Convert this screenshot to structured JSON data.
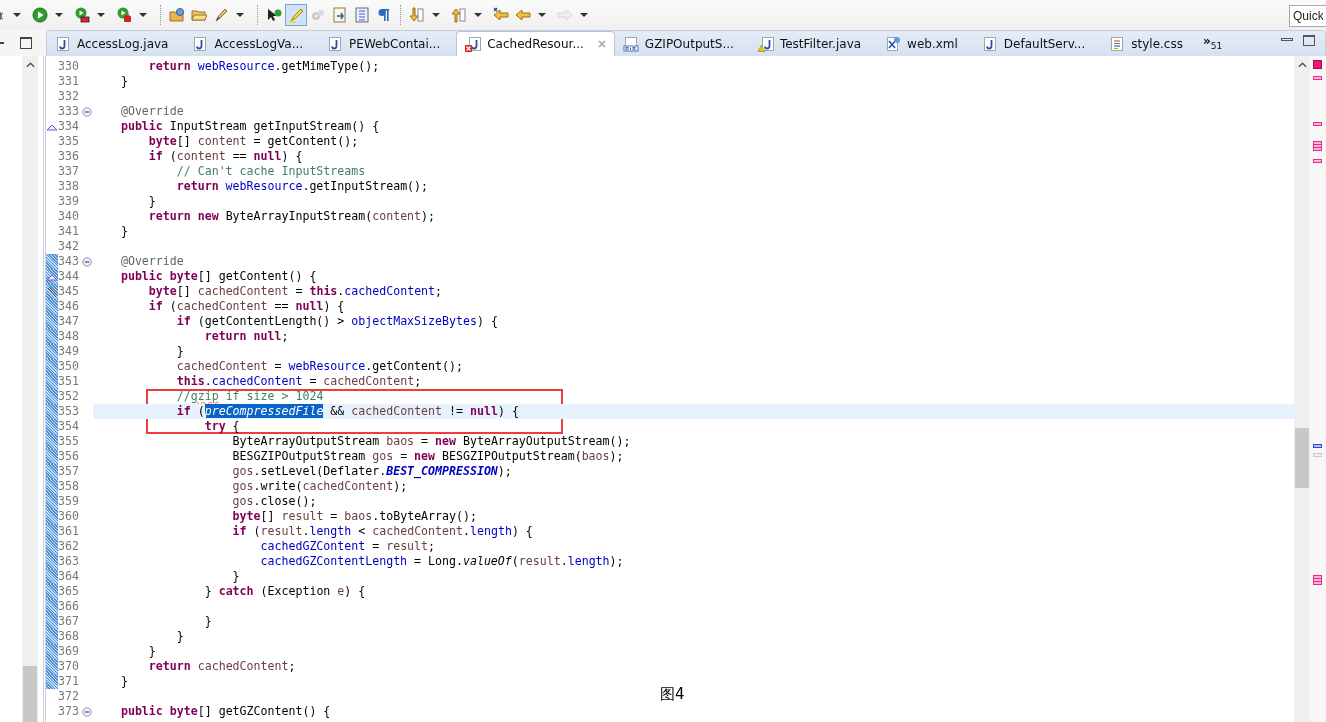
{
  "toolbar": [
    {
      "kind": "debug",
      "menu": true,
      "on": false,
      "disabled": false
    },
    {
      "kind": "run",
      "menu": true,
      "on": false,
      "disabled": false
    },
    {
      "kind": "coverage",
      "menu": true,
      "on": false,
      "disabled": false
    },
    {
      "kind": "external-tools",
      "menu": true,
      "on": false,
      "disabled": false
    },
    {
      "kind": "separator"
    },
    {
      "kind": "open-project",
      "menu": false,
      "on": false,
      "disabled": false
    },
    {
      "kind": "open-folder",
      "menu": false,
      "on": false,
      "disabled": false
    },
    {
      "kind": "brush",
      "menu": true,
      "on": false,
      "disabled": false
    },
    {
      "kind": "separator"
    },
    {
      "kind": "cursor-run",
      "menu": false,
      "on": false,
      "disabled": false
    },
    {
      "kind": "highlighter",
      "menu": false,
      "on": true,
      "disabled": false
    },
    {
      "kind": "gears",
      "menu": false,
      "on": false,
      "disabled": true
    },
    {
      "kind": "doc-arrow",
      "menu": false,
      "on": false,
      "disabled": false
    },
    {
      "kind": "doc-list",
      "menu": false,
      "on": false,
      "disabled": false
    },
    {
      "kind": "pilcrow",
      "menu": false,
      "on": false,
      "disabled": false
    },
    {
      "kind": "separator"
    },
    {
      "kind": "next-annotation",
      "menu": true,
      "on": false,
      "disabled": false
    },
    {
      "kind": "prev-annotation",
      "menu": true,
      "on": false,
      "disabled": false
    },
    {
      "kind": "last-edit",
      "menu": false,
      "on": false,
      "disabled": false
    },
    {
      "kind": "back",
      "menu": true,
      "on": false,
      "disabled": false
    },
    {
      "kind": "forward",
      "menu": true,
      "on": false,
      "disabled": true
    }
  ],
  "quick_access": {
    "placeholder": "Quick"
  },
  "tabs": [
    {
      "label": "AccessLog.java",
      "kind": "java",
      "selected": false
    },
    {
      "label": "AccessLogVa...",
      "kind": "java",
      "selected": false
    },
    {
      "label": "PEWebContai...",
      "kind": "java",
      "selected": false
    },
    {
      "label": "CachedResour...",
      "kind": "java-error",
      "selected": true
    },
    {
      "label": "GZIPOutputS...",
      "kind": "class",
      "selected": false
    },
    {
      "label": "TestFilter.java",
      "kind": "java-warning",
      "selected": false
    },
    {
      "label": "web.xml",
      "kind": "xml",
      "selected": false
    },
    {
      "label": "DefaultServ...",
      "kind": "java",
      "selected": false
    },
    {
      "label": "style.css",
      "kind": "css",
      "selected": false
    }
  ],
  "tab_overflow": {
    "symbol": "»",
    "count": "51"
  },
  "lines": [
    {
      "number": "330",
      "changed": false,
      "current": false,
      "boxed": false,
      "tokens": [
        {
          "kind": "kw",
          "text": "        return"
        },
        {
          "kind": "field",
          "text": " webResource"
        },
        {
          "kind": "plain",
          "text": ".getMimeType();"
        }
      ]
    },
    {
      "number": "331",
      "changed": false,
      "current": false,
      "boxed": false,
      "tokens": [
        {
          "kind": "plain",
          "text": "    }"
        }
      ]
    },
    {
      "number": "332",
      "changed": false,
      "current": false,
      "boxed": false
    },
    {
      "number": "333",
      "changed": false,
      "current": false,
      "boxed": false,
      "fold": {
        "collapsed": false
      },
      "tokens": [
        {
          "kind": "annot",
          "text": "    @Override"
        }
      ]
    },
    {
      "number": "334",
      "changed": false,
      "current": false,
      "boxed": false,
      "marker": {
        "kind": "override"
      },
      "tokens": [
        {
          "kind": "kw",
          "text": "    public"
        },
        {
          "kind": "plain",
          "text": " InputStream getInputStream() {"
        }
      ]
    },
    {
      "number": "335",
      "changed": false,
      "current": false,
      "boxed": false,
      "tokens": [
        {
          "kind": "kw",
          "text": "        byte"
        },
        {
          "kind": "plain",
          "text": "[] "
        },
        {
          "kind": "local",
          "text": "content"
        },
        {
          "kind": "plain",
          "text": " = getContent();"
        }
      ]
    },
    {
      "number": "336",
      "changed": false,
      "current": false,
      "boxed": false,
      "tokens": [
        {
          "kind": "kw",
          "text": "        if"
        },
        {
          "kind": "plain",
          "text": " ("
        },
        {
          "kind": "local",
          "text": "content"
        },
        {
          "kind": "plain",
          "text": " =="
        },
        {
          "kind": "kw",
          "text": " null"
        },
        {
          "kind": "plain",
          "text": ") {"
        }
      ]
    },
    {
      "number": "337",
      "changed": false,
      "current": false,
      "boxed": false,
      "tokens": [
        {
          "kind": "comment",
          "text": "            // Can't cache InputStreams"
        }
      ]
    },
    {
      "number": "338",
      "changed": false,
      "current": false,
      "boxed": false,
      "tokens": [
        {
          "kind": "kw",
          "text": "            return"
        },
        {
          "kind": "field",
          "text": " webResource"
        },
        {
          "kind": "plain",
          "text": ".getInputStream();"
        }
      ]
    },
    {
      "number": "339",
      "changed": false,
      "current": false,
      "boxed": false,
      "tokens": [
        {
          "kind": "plain",
          "text": "        }"
        }
      ]
    },
    {
      "number": "340",
      "changed": false,
      "current": false,
      "boxed": false,
      "tokens": [
        {
          "kind": "kw",
          "text": "        return"
        },
        {
          "kind": "kw",
          "text": " new"
        },
        {
          "kind": "plain",
          "text": " ByteArrayInputStream("
        },
        {
          "kind": "local",
          "text": "content"
        },
        {
          "kind": "plain",
          "text": ");"
        }
      ]
    },
    {
      "number": "341",
      "changed": false,
      "current": false,
      "boxed": false,
      "tokens": [
        {
          "kind": "plain",
          "text": "    }"
        }
      ]
    },
    {
      "number": "342",
      "changed": false,
      "current": false,
      "boxed": false
    },
    {
      "number": "343",
      "changed": true,
      "current": false,
      "boxed": false,
      "fold": {
        "collapsed": false
      },
      "tokens": [
        {
          "kind": "annot",
          "text": "    @Override"
        }
      ]
    },
    {
      "number": "344",
      "changed": true,
      "current": false,
      "boxed": false,
      "marker": {
        "kind": "override"
      },
      "tokens": [
        {
          "kind": "kw",
          "text": "    public"
        },
        {
          "kind": "kw",
          "text": " byte"
        },
        {
          "kind": "plain",
          "text": "[] getContent() {"
        }
      ]
    },
    {
      "number": "345",
      "changed": true,
      "current": false,
      "boxed": false,
      "marker": {
        "kind": "deleted"
      },
      "tokens": [
        {
          "kind": "kw",
          "text": "        byte"
        },
        {
          "kind": "plain",
          "text": "[] "
        },
        {
          "kind": "local",
          "text": "cachedContent"
        },
        {
          "kind": "plain",
          "text": " ="
        },
        {
          "kind": "kw",
          "text": " this"
        },
        {
          "kind": "plain",
          "text": "."
        },
        {
          "kind": "field",
          "text": "cachedContent"
        },
        {
          "kind": "plain",
          "text": ";"
        }
      ]
    },
    {
      "number": "346",
      "changed": true,
      "current": false,
      "boxed": false,
      "tokens": [
        {
          "kind": "kw",
          "text": "        if"
        },
        {
          "kind": "plain",
          "text": " ("
        },
        {
          "kind": "local",
          "text": "cachedContent"
        },
        {
          "kind": "plain",
          "text": " =="
        },
        {
          "kind": "kw",
          "text": " null"
        },
        {
          "kind": "plain",
          "text": ") {"
        }
      ]
    },
    {
      "number": "347",
      "changed": true,
      "current": false,
      "boxed": false,
      "tokens": [
        {
          "kind": "kw",
          "text": "            if"
        },
        {
          "kind": "plain",
          "text": " (getContentLength() >"
        },
        {
          "kind": "field",
          "text": " objectMaxSizeBytes"
        },
        {
          "kind": "plain",
          "text": ") {"
        }
      ]
    },
    {
      "number": "348",
      "changed": true,
      "current": false,
      "boxed": false,
      "tokens": [
        {
          "kind": "kw",
          "text": "                return"
        },
        {
          "kind": "kw",
          "text": " null"
        },
        {
          "kind": "plain",
          "text": ";"
        }
      ]
    },
    {
      "number": "349",
      "changed": true,
      "current": false,
      "boxed": false,
      "tokens": [
        {
          "kind": "plain",
          "text": "            }"
        }
      ]
    },
    {
      "number": "350",
      "changed": true,
      "current": false,
      "boxed": false,
      "tokens": [
        {
          "kind": "local",
          "text": "            cachedContent"
        },
        {
          "kind": "plain",
          "text": " ="
        },
        {
          "kind": "field",
          "text": " webResource"
        },
        {
          "kind": "plain",
          "text": ".getContent();"
        }
      ]
    },
    {
      "number": "351",
      "changed": true,
      "current": false,
      "boxed": false,
      "tokens": [
        {
          "kind": "kw",
          "text": "            this"
        },
        {
          "kind": "plain",
          "text": "."
        },
        {
          "kind": "field",
          "text": "cachedContent"
        },
        {
          "kind": "plain",
          "text": " ="
        },
        {
          "kind": "local",
          "text": " cachedContent"
        },
        {
          "kind": "plain",
          "text": ";"
        }
      ]
    },
    {
      "number": "352",
      "changed": true,
      "current": false,
      "boxed": true,
      "tokens": [
        {
          "kind": "comment",
          "text": "            //"
        },
        {
          "kind": "comment-typo",
          "text": "gzip"
        },
        {
          "kind": "comment",
          "text": " if size > 1024"
        }
      ]
    },
    {
      "number": "353",
      "changed": true,
      "current": true,
      "boxed": true,
      "tokens": [
        {
          "kind": "kw",
          "text": "            if"
        },
        {
          "kind": "plain",
          "text": " ("
        },
        {
          "kind": "selected",
          "text": "preCompressedFile"
        },
        {
          "kind": "plain",
          "text": " &&"
        },
        {
          "kind": "local",
          "text": " cachedContent"
        },
        {
          "kind": "plain",
          "text": " !="
        },
        {
          "kind": "kw",
          "text": " null"
        },
        {
          "kind": "plain",
          "text": ") {"
        }
      ]
    },
    {
      "number": "354",
      "changed": true,
      "current": false,
      "boxed": true,
      "tokens": [
        {
          "kind": "kw",
          "text": "                try"
        },
        {
          "kind": "plain",
          "text": " {"
        }
      ]
    },
    {
      "number": "355",
      "changed": true,
      "current": false,
      "boxed": false,
      "tokens": [
        {
          "kind": "plain",
          "text": "                    ByteArrayOutputStream"
        },
        {
          "kind": "local",
          "text": " baos"
        },
        {
          "kind": "plain",
          "text": " ="
        },
        {
          "kind": "kw",
          "text": " new"
        },
        {
          "kind": "plain",
          "text": " ByteArrayOutputStream();"
        }
      ]
    },
    {
      "number": "356",
      "changed": true,
      "current": false,
      "boxed": false,
      "tokens": [
        {
          "kind": "plain",
          "text": "                    BESGZIPOutputStream"
        },
        {
          "kind": "local",
          "text": " gos"
        },
        {
          "kind": "plain",
          "text": " ="
        },
        {
          "kind": "kw",
          "text": " new"
        },
        {
          "kind": "plain",
          "text": " BESGZIPOutputStream("
        },
        {
          "kind": "local",
          "text": "baos"
        },
        {
          "kind": "plain",
          "text": ");"
        }
      ]
    },
    {
      "number": "357",
      "changed": true,
      "current": false,
      "boxed": false,
      "tokens": [
        {
          "kind": "local",
          "text": "                    gos"
        },
        {
          "kind": "plain",
          "text": ".setLevel(Deflater."
        },
        {
          "kind": "static",
          "text": "BEST_COMPRESSION"
        },
        {
          "kind": "plain",
          "text": ");"
        }
      ]
    },
    {
      "number": "358",
      "changed": true,
      "current": false,
      "boxed": false,
      "tokens": [
        {
          "kind": "local",
          "text": "                    gos"
        },
        {
          "kind": "plain",
          "text": ".write("
        },
        {
          "kind": "local",
          "text": "cachedContent"
        },
        {
          "kind": "plain",
          "text": ");"
        }
      ]
    },
    {
      "number": "359",
      "changed": true,
      "current": false,
      "boxed": false,
      "tokens": [
        {
          "kind": "local",
          "text": "                    gos"
        },
        {
          "kind": "plain",
          "text": ".close();"
        }
      ]
    },
    {
      "number": "360",
      "changed": true,
      "current": false,
      "boxed": false,
      "tokens": [
        {
          "kind": "kw",
          "text": "                    byte"
        },
        {
          "kind": "plain",
          "text": "[] "
        },
        {
          "kind": "local",
          "text": "result"
        },
        {
          "kind": "plain",
          "text": " ="
        },
        {
          "kind": "local",
          "text": " baos"
        },
        {
          "kind": "plain",
          "text": ".toByteArray();"
        }
      ]
    },
    {
      "number": "361",
      "changed": true,
      "current": false,
      "boxed": false,
      "tokens": [
        {
          "kind": "kw",
          "text": "                    if"
        },
        {
          "kind": "plain",
          "text": " ("
        },
        {
          "kind": "local",
          "text": "result"
        },
        {
          "kind": "plain",
          "text": "."
        },
        {
          "kind": "field",
          "text": "length"
        },
        {
          "kind": "plain",
          "text": " <"
        },
        {
          "kind": "local",
          "text": " cachedContent"
        },
        {
          "kind": "plain",
          "text": "."
        },
        {
          "kind": "field",
          "text": "length"
        },
        {
          "kind": "plain",
          "text": ") {"
        }
      ]
    },
    {
      "number": "362",
      "changed": true,
      "current": false,
      "boxed": false,
      "tokens": [
        {
          "kind": "field",
          "text": "                        cachedGZContent"
        },
        {
          "kind": "plain",
          "text": " ="
        },
        {
          "kind": "local",
          "text": " result"
        },
        {
          "kind": "plain",
          "text": ";"
        }
      ]
    },
    {
      "number": "363",
      "changed": true,
      "current": false,
      "boxed": false,
      "tokens": [
        {
          "kind": "field",
          "text": "                        cachedGZContentLength"
        },
        {
          "kind": "plain",
          "text": " = Long."
        },
        {
          "kind": "italic",
          "text": "valueOf"
        },
        {
          "kind": "plain",
          "text": "("
        },
        {
          "kind": "local",
          "text": "result"
        },
        {
          "kind": "plain",
          "text": "."
        },
        {
          "kind": "field",
          "text": "length"
        },
        {
          "kind": "plain",
          "text": ");"
        }
      ]
    },
    {
      "number": "364",
      "changed": true,
      "current": false,
      "boxed": false,
      "tokens": [
        {
          "kind": "plain",
          "text": "                    }"
        }
      ]
    },
    {
      "number": "365",
      "changed": true,
      "current": false,
      "boxed": false,
      "tokens": [
        {
          "kind": "plain",
          "text": "                }"
        },
        {
          "kind": "kw",
          "text": " catch"
        },
        {
          "kind": "plain",
          "text": " (Exception"
        },
        {
          "kind": "local",
          "text": " e"
        },
        {
          "kind": "plain",
          "text": ") {"
        }
      ]
    },
    {
      "number": "366",
      "changed": true,
      "current": false,
      "boxed": false
    },
    {
      "number": "367",
      "changed": true,
      "current": false,
      "boxed": false,
      "tokens": [
        {
          "kind": "plain",
          "text": "                }"
        }
      ]
    },
    {
      "number": "368",
      "changed": true,
      "current": false,
      "boxed": false,
      "tokens": [
        {
          "kind": "plain",
          "text": "            }"
        }
      ]
    },
    {
      "number": "369",
      "changed": true,
      "current": false,
      "boxed": false,
      "tokens": [
        {
          "kind": "plain",
          "text": "        }"
        }
      ]
    },
    {
      "number": "370",
      "changed": true,
      "current": false,
      "boxed": false,
      "tokens": [
        {
          "kind": "kw",
          "text": "        return"
        },
        {
          "kind": "local",
          "text": " cachedContent"
        },
        {
          "kind": "plain",
          "text": ";"
        }
      ]
    },
    {
      "number": "371",
      "changed": true,
      "current": false,
      "boxed": false,
      "tokens": [
        {
          "kind": "plain",
          "text": "    }"
        }
      ]
    },
    {
      "number": "372",
      "changed": false,
      "current": false,
      "boxed": false
    },
    {
      "number": "373",
      "changed": false,
      "current": false,
      "boxed": false,
      "fold": {
        "collapsed": false
      },
      "tokens": [
        {
          "kind": "kw",
          "text": "    public"
        },
        {
          "kind": "kw",
          "text": " byte"
        },
        {
          "kind": "plain",
          "text": "[] getGZContent() {"
        }
      ]
    }
  ],
  "caption": "图4"
}
